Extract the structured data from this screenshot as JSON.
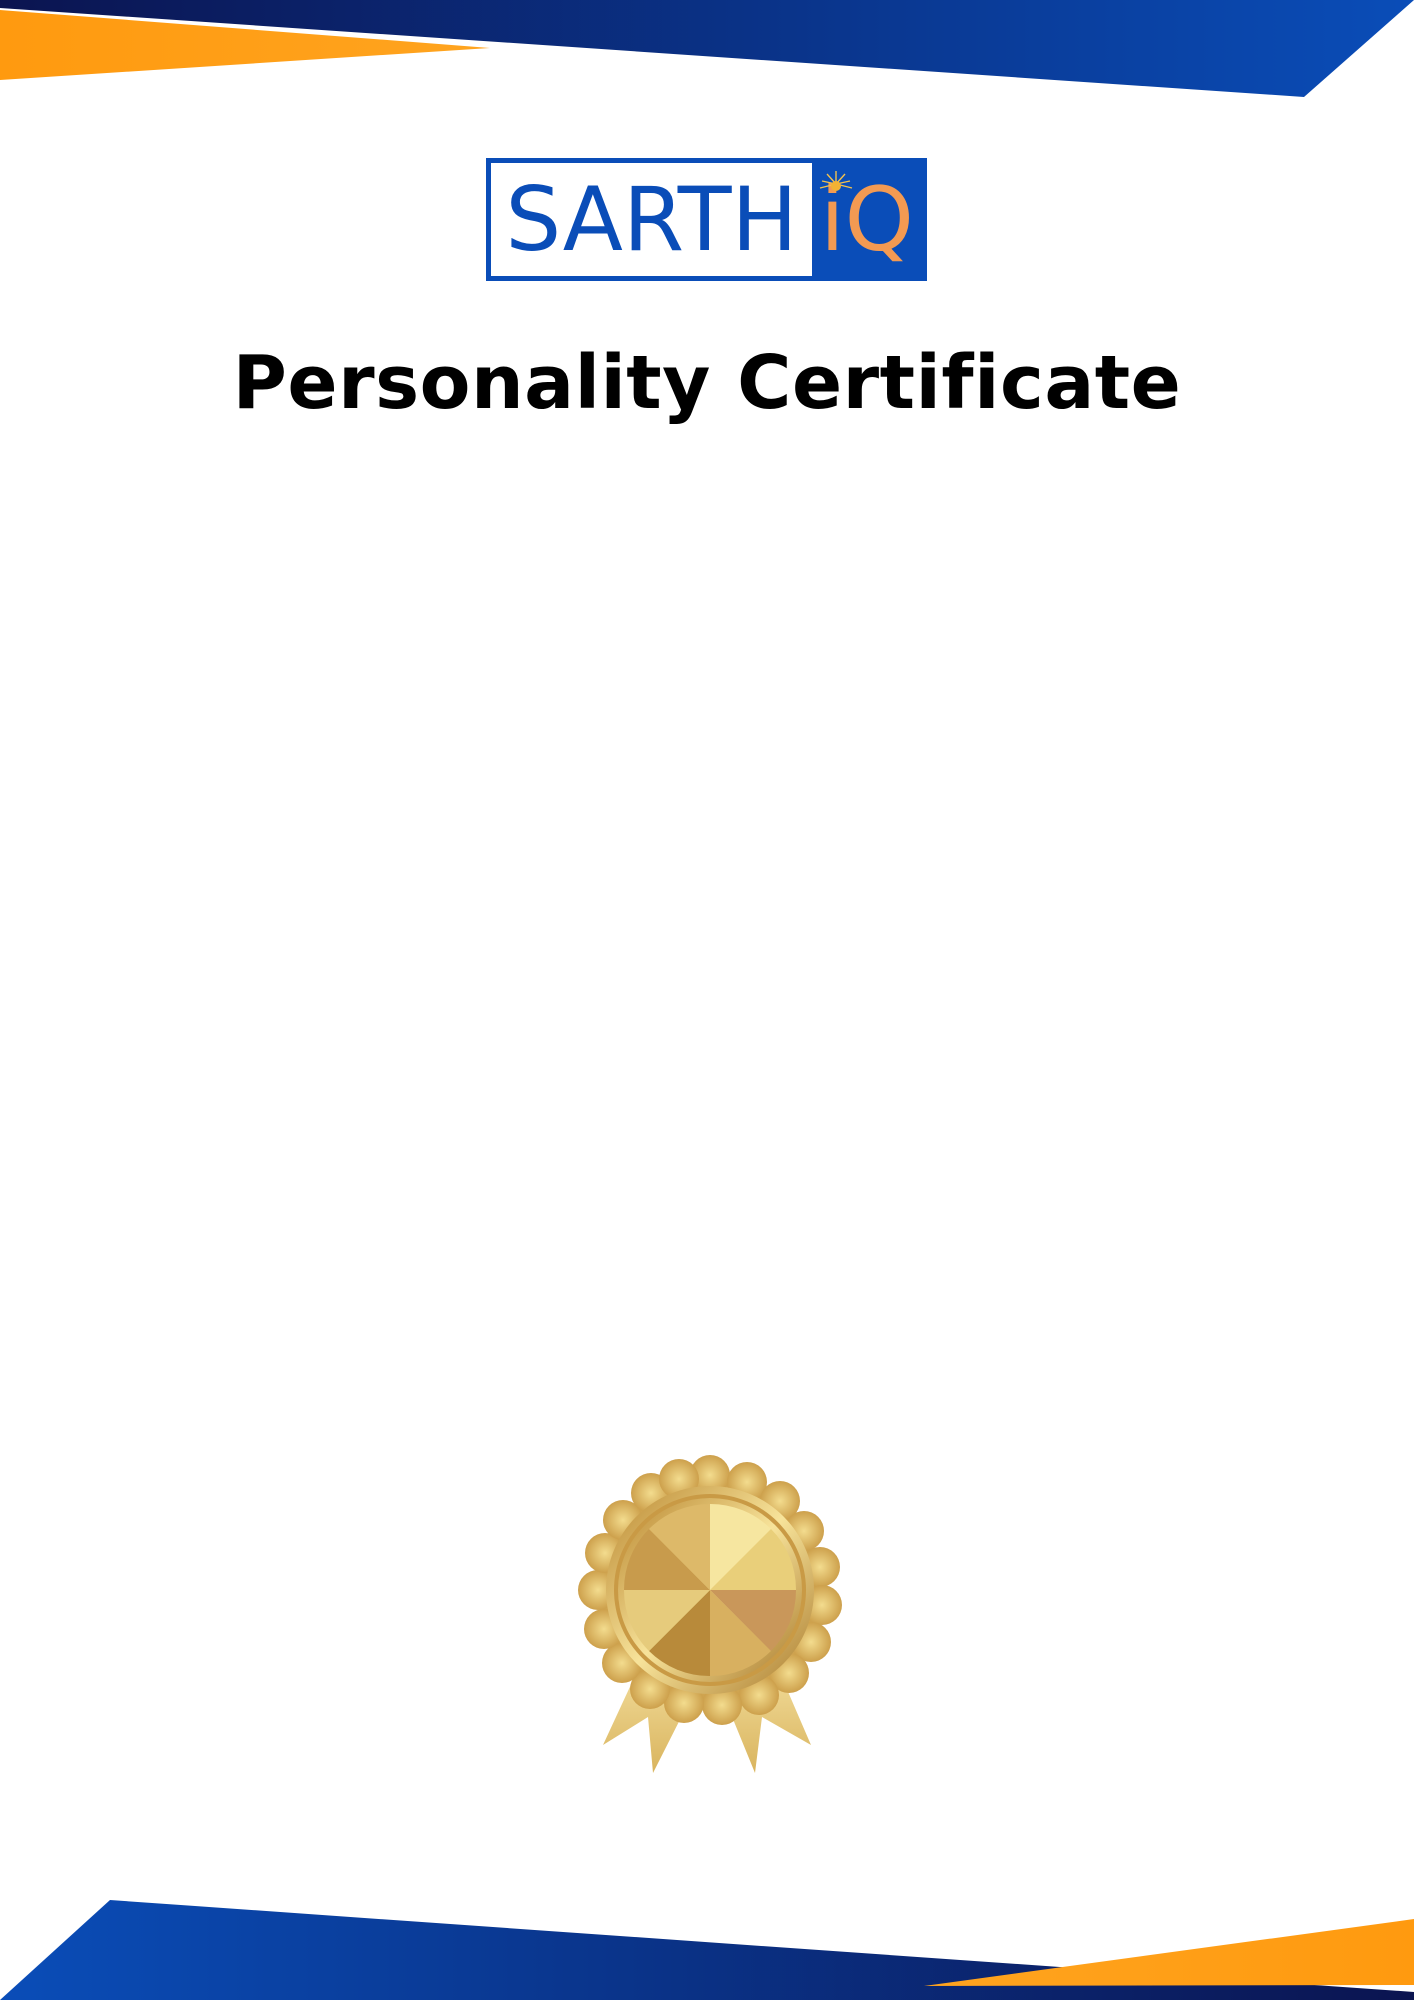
{
  "logo": {
    "part1": "SARTH",
    "part2": "iQ"
  },
  "certificate": {
    "title": "Personality Certificate"
  },
  "colors": {
    "brand_blue": "#0a4db8",
    "navy": "#0b1450",
    "orange": "#ff9a0f",
    "logo_accent": "#f39a52",
    "gold": "#d8b25a"
  },
  "decorations": {
    "top_band": "blue-gradient-band-with-orange-wedge",
    "bottom_band": "blue-gradient-band-with-orange-wedge",
    "seal": "gold-medal-seal-with-ribbons"
  }
}
